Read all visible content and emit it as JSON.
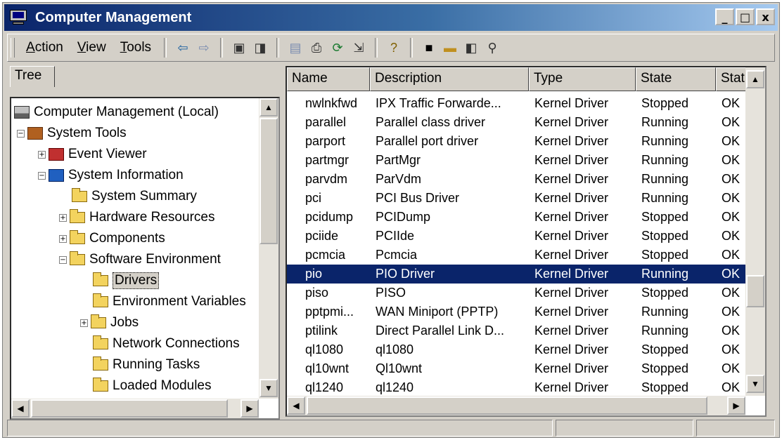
{
  "window": {
    "title": "Computer Management",
    "controls": {
      "minimize": "_",
      "maximize": "□",
      "close": "x"
    }
  },
  "menu": {
    "action": {
      "first": "A",
      "rest": "ction"
    },
    "view": {
      "first": "V",
      "rest": "iew"
    },
    "tools": {
      "first": "T",
      "rest": "ools"
    }
  },
  "toolbar_icons": {
    "back": "⇦",
    "forward": "⇨",
    "up": "▣",
    "show_tree": "◨",
    "properties": "▤",
    "print": "⎙",
    "refresh": "⟳",
    "export": "⇲",
    "help": "?",
    "save": "■",
    "open": "▬",
    "stop": "◧",
    "find": "⚲"
  },
  "tree": {
    "tab_label": "Tree",
    "nodes": [
      {
        "label": "Computer Management (Local)"
      },
      {
        "label": "System Tools",
        "pm": "−"
      },
      {
        "label": "Event Viewer",
        "pm": "+"
      },
      {
        "label": "System Information",
        "pm": "−"
      },
      {
        "label": "System Summary"
      },
      {
        "label": "Hardware Resources",
        "pm": "+"
      },
      {
        "label": "Components",
        "pm": "+"
      },
      {
        "label": "Software Environment",
        "pm": "−"
      },
      {
        "label": "Drivers"
      },
      {
        "label": "Environment Variables"
      },
      {
        "label": "Jobs",
        "pm": "+"
      },
      {
        "label": "Network Connections"
      },
      {
        "label": "Running Tasks"
      },
      {
        "label": "Loaded Modules"
      }
    ]
  },
  "list": {
    "columns": [
      "Name",
      "Description",
      "Type",
      "State",
      "Status"
    ],
    "rows": [
      [
        "nwlnkfwd",
        "IPX Traffic Forwarde...",
        "Kernel Driver",
        "Stopped",
        "OK"
      ],
      [
        "parallel",
        "Parallel class driver",
        "Kernel Driver",
        "Running",
        "OK"
      ],
      [
        "parport",
        "Parallel port driver",
        "Kernel Driver",
        "Running",
        "OK"
      ],
      [
        "partmgr",
        "PartMgr",
        "Kernel Driver",
        "Running",
        "OK"
      ],
      [
        "parvdm",
        "ParVdm",
        "Kernel Driver",
        "Running",
        "OK"
      ],
      [
        "pci",
        "PCI Bus Driver",
        "Kernel Driver",
        "Running",
        "OK"
      ],
      [
        "pcidump",
        "PCIDump",
        "Kernel Driver",
        "Stopped",
        "OK"
      ],
      [
        "pciide",
        "PCIIde",
        "Kernel Driver",
        "Stopped",
        "OK"
      ],
      [
        "pcmcia",
        "Pcmcia",
        "Kernel Driver",
        "Stopped",
        "OK"
      ],
      [
        "pio",
        "PIO Driver",
        "Kernel Driver",
        "Running",
        "OK"
      ],
      [
        "piso",
        "PISO",
        "Kernel Driver",
        "Stopped",
        "OK"
      ],
      [
        "pptpmi...",
        "WAN Miniport (PPTP)",
        "Kernel Driver",
        "Running",
        "OK"
      ],
      [
        "ptilink",
        "Direct Parallel Link D...",
        "Kernel Driver",
        "Running",
        "OK"
      ],
      [
        "ql1080",
        "ql1080",
        "Kernel Driver",
        "Stopped",
        "OK"
      ],
      [
        "ql10wnt",
        "Ql10wnt",
        "Kernel Driver",
        "Stopped",
        "OK"
      ],
      [
        "ql1240",
        "ql1240",
        "Kernel Driver",
        "Stopped",
        "OK"
      ]
    ]
  },
  "scroll_glyphs": {
    "up": "▲",
    "down": "▼",
    "left": "◀",
    "right": "▶"
  },
  "colors": {
    "selection": "#0a246a",
    "title_start": "#0a246a",
    "title_end": "#a6caf0",
    "face": "#d4d0c8"
  }
}
